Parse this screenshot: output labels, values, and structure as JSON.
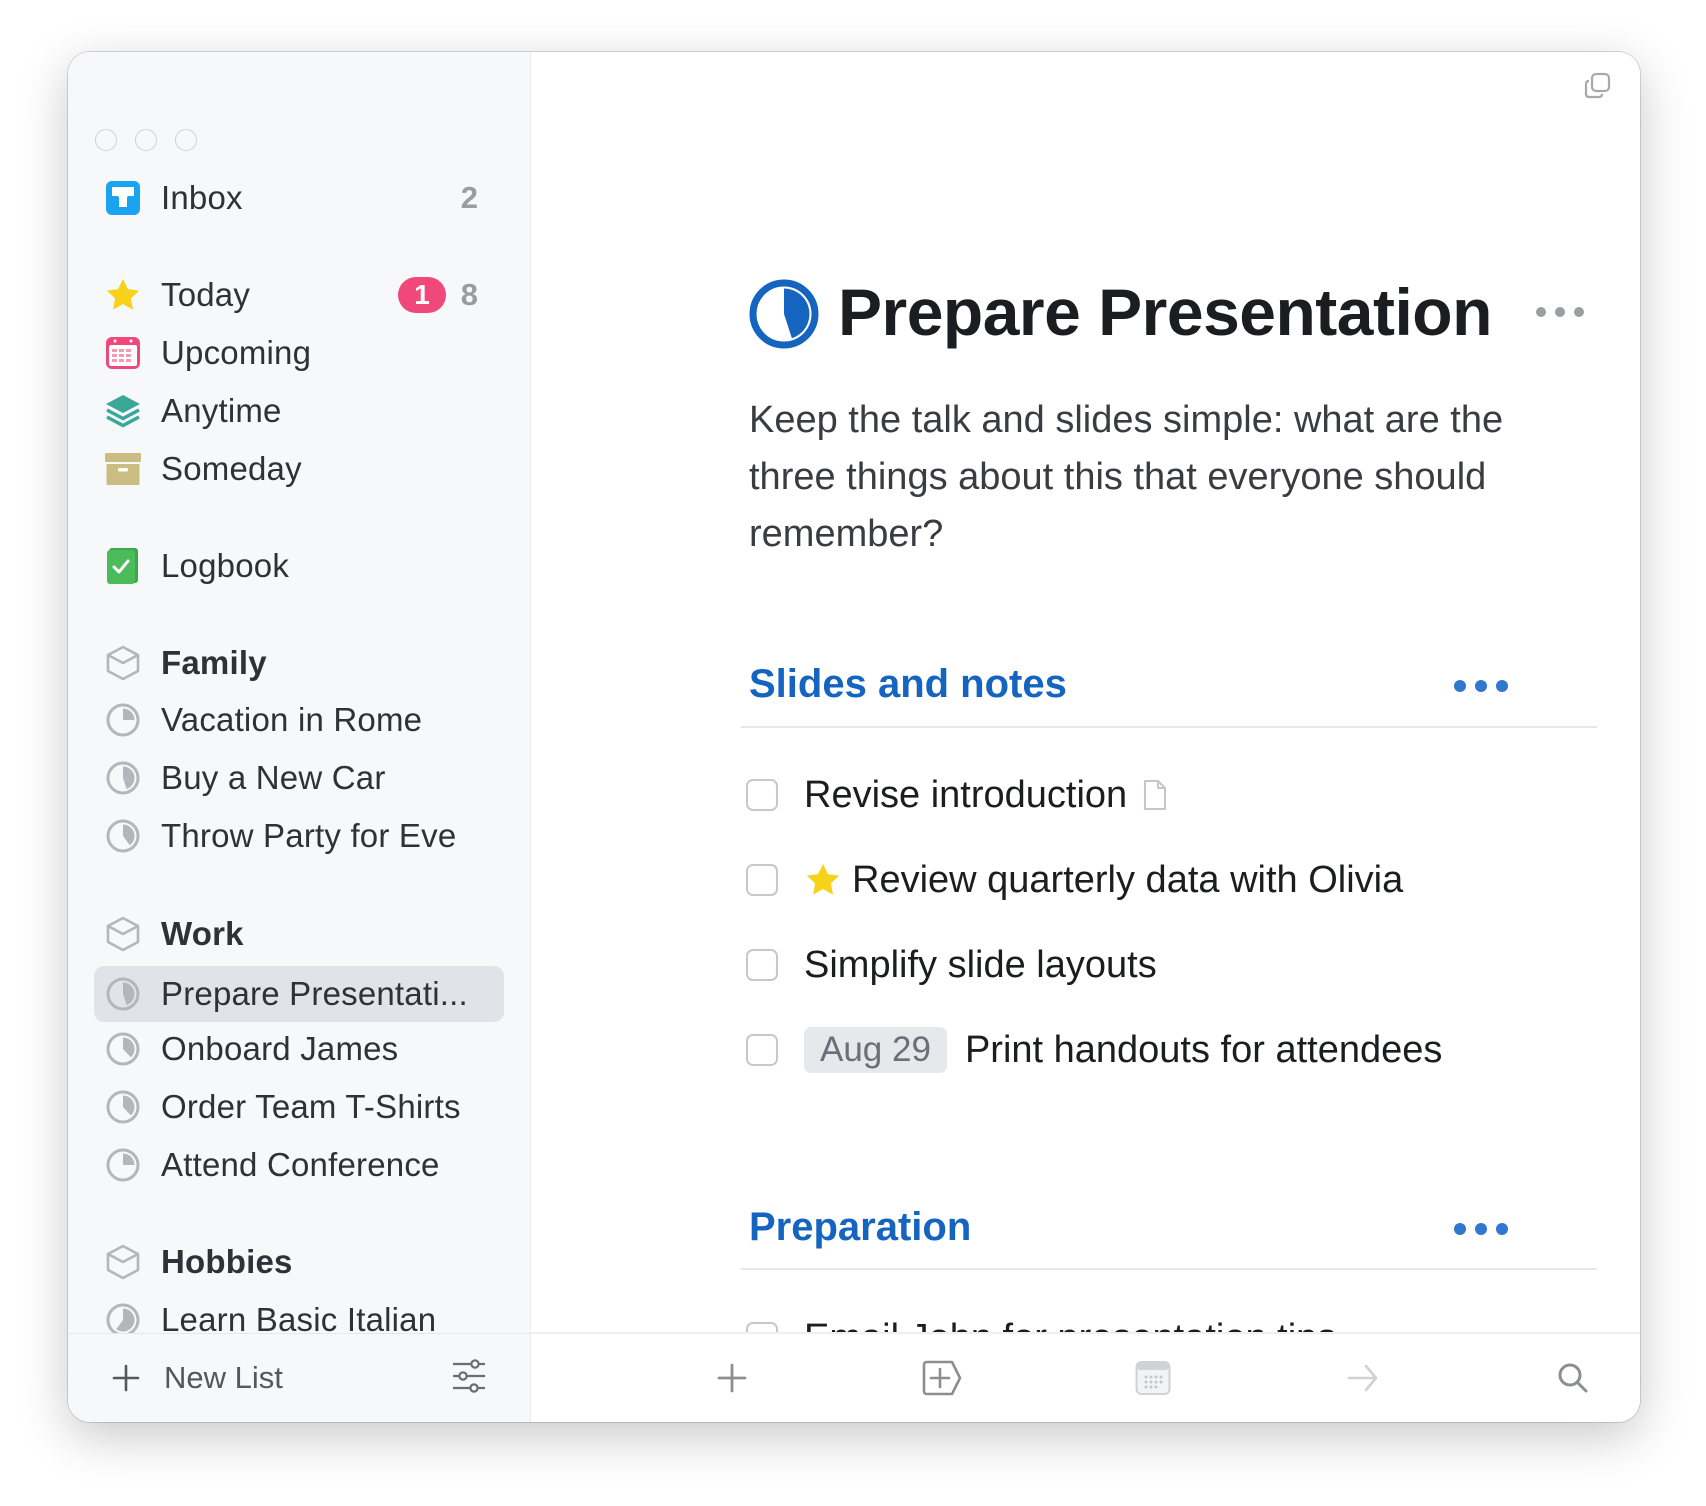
{
  "window": {
    "traffic_lights": [
      "close",
      "minimize",
      "zoom"
    ]
  },
  "sidebar": {
    "inbox": {
      "label": "Inbox",
      "count": "2",
      "icon": "inbox-icon",
      "color": "#1aa3f0"
    },
    "today": {
      "label": "Today",
      "badge": "1",
      "count": "8",
      "icon": "star-icon",
      "color": "#f7d21b",
      "badge_color": "#f0487a"
    },
    "upcoming": {
      "label": "Upcoming",
      "icon": "calendar-icon",
      "color": "#f0487a"
    },
    "anytime": {
      "label": "Anytime",
      "icon": "layers-icon",
      "color": "#3aa798"
    },
    "someday": {
      "label": "Someday",
      "icon": "archive-box-icon",
      "color": "#cbbd82"
    },
    "logbook": {
      "label": "Logbook",
      "icon": "logbook-icon",
      "color": "#4cbb5a"
    },
    "areas": [
      {
        "label": "Family",
        "projects": [
          {
            "label": "Vacation in Rome",
            "progress": 0.25
          },
          {
            "label": "Buy a New Car",
            "progress": 0.45
          },
          {
            "label": "Throw Party for Eve",
            "progress": 0.4
          }
        ]
      },
      {
        "label": "Work",
        "projects": [
          {
            "label": "Prepare Presentati...",
            "progress": 0.45,
            "selected": true
          },
          {
            "label": "Onboard James",
            "progress": 0.38
          },
          {
            "label": "Order Team T-Shirts",
            "progress": 0.38
          },
          {
            "label": "Attend Conference",
            "progress": 0.25
          }
        ]
      },
      {
        "label": "Hobbies",
        "projects": [
          {
            "label": "Learn Basic Italian",
            "progress": 0.6
          }
        ]
      }
    ],
    "new_list_label": "New List"
  },
  "main": {
    "title": "Prepare Presentation",
    "title_progress": 0.45,
    "accent_color": "#1565c0",
    "notes": "Keep the talk and slides simple: what are the three things about this that everyone should remember?",
    "sections": [
      {
        "heading": "Slides and notes",
        "tasks": [
          {
            "title": "Revise introduction",
            "has_note": true
          },
          {
            "title": "Review quarterly data with Olivia",
            "starred": true
          },
          {
            "title": "Simplify slide layouts"
          },
          {
            "title": "Print handouts for attendees",
            "date": "Aug 29"
          }
        ]
      },
      {
        "heading": "Preparation",
        "tasks": [
          {
            "title": "Email John for presentation tips"
          }
        ]
      }
    ]
  },
  "toolbar": {
    "buttons": [
      "new-todo",
      "new-heading",
      "when",
      "move",
      "quick-find"
    ]
  }
}
